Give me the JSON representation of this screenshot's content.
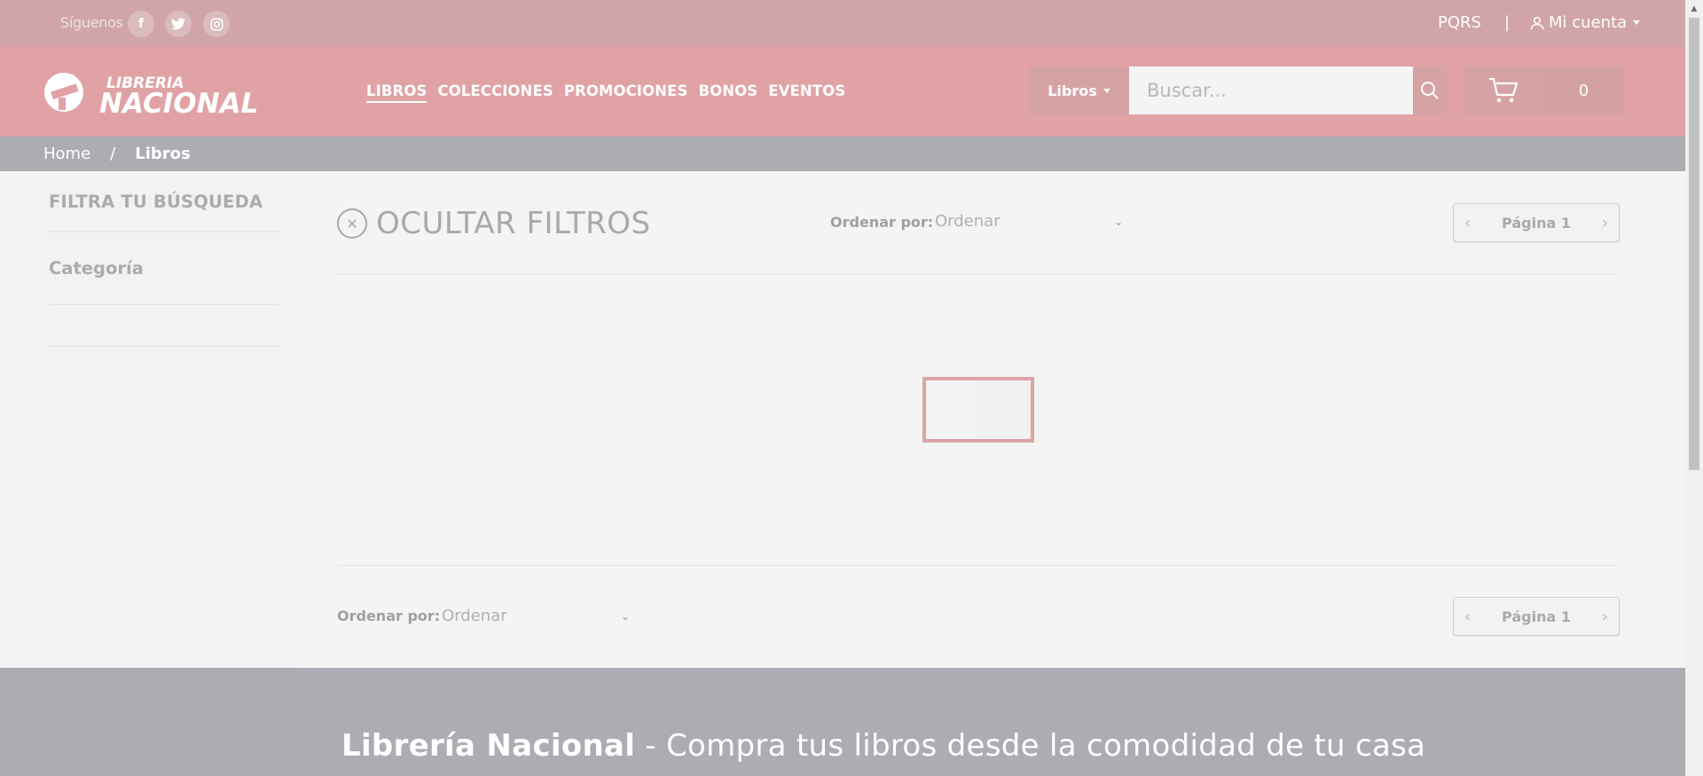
{
  "topbar": {
    "follow_label": "Síguenos",
    "social": [
      {
        "name": "facebook-icon",
        "glyph": "f"
      },
      {
        "name": "twitter-icon",
        "glyph": "t"
      },
      {
        "name": "instagram-icon",
        "glyph": "i"
      }
    ],
    "pqrs_label": "PQRS",
    "separator": "|",
    "account_label": "Mi cuenta"
  },
  "header": {
    "logo_top": "LIBRERIA",
    "logo_bottom": "NACIONAL",
    "nav": [
      {
        "label": "LIBROS",
        "active": true
      },
      {
        "label": "COLECCIONES",
        "active": false
      },
      {
        "label": "PROMOCIONES",
        "active": false
      },
      {
        "label": "BONOS",
        "active": false
      },
      {
        "label": "EVENTOS",
        "active": false
      }
    ],
    "search_category": "Libros",
    "search_placeholder": "Buscar...",
    "cart_count": "0"
  },
  "breadcrumb": {
    "home": "Home",
    "separator": "/",
    "current": "Libros"
  },
  "sidebar": {
    "filter_title": "FILTRA TU BÚSQUEDA",
    "category_label": "Categoría"
  },
  "main": {
    "hide_filters_label": "OCULTAR FILTROS",
    "sort_label": "Ordenar por:",
    "sort_value": "Ordenar",
    "page_label": "Página 1"
  },
  "footer": {
    "brand": "Librería Nacional",
    "tagline": " - Compra tus libros desde la comodidad de tu casa"
  },
  "colors": {
    "topbar": "#d1a5a7",
    "header": "#e0a2a5",
    "breadcrumb": "#abadb3",
    "footer": "#abadb3",
    "loader_border": "#dca4a6"
  }
}
